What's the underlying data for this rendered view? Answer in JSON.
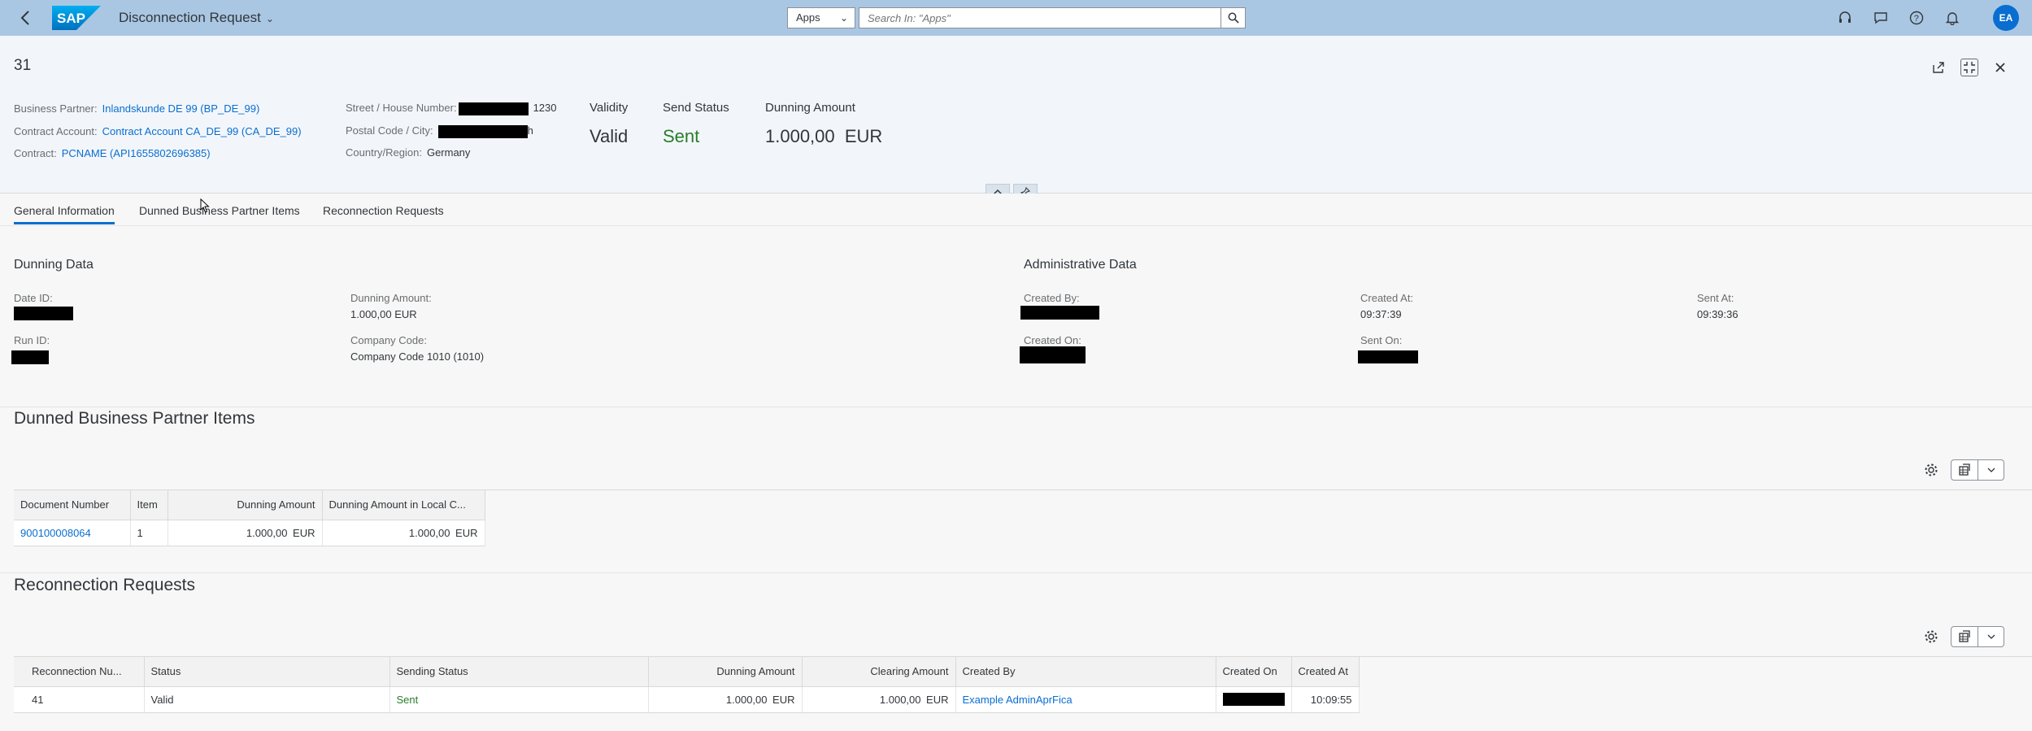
{
  "shell": {
    "title": "Disconnection Request",
    "search_scope": "Apps",
    "search_placeholder": "Search In: \"Apps\"",
    "avatar_initials": "EA",
    "colors": {
      "bar": "#a9c7e3",
      "avatar": "#0a6ed1"
    }
  },
  "header": {
    "object_id": "31",
    "business_partner_label": "Business Partner:",
    "business_partner_value": "Inlandskunde DE 99 (BP_DE_99)",
    "contract_account_label": "Contract Account:",
    "contract_account_value": "Contract Account CA_DE_99 (CA_DE_99)",
    "contract_label": "Contract:",
    "contract_value": "PCNAME (API1655802696385)",
    "street_label": "Street / House Number:",
    "street_suffix": "1230",
    "postal_label": "Postal Code / City:",
    "postal_suffix": "h",
    "country_label": "Country/Region:",
    "country_value": "Germany",
    "validity_label": "Validity",
    "validity_value": "Valid",
    "send_status_label": "Send Status",
    "send_status_value": "Sent",
    "dunning_amount_label": "Dunning Amount",
    "dunning_amount_value": "1.000,00",
    "dunning_amount_currency": "EUR"
  },
  "tabs": [
    {
      "label": "General Information"
    },
    {
      "label": "Dunned Business Partner Items"
    },
    {
      "label": "Reconnection Requests"
    }
  ],
  "general": {
    "dunning_data_title": "Dunning Data",
    "date_id_label": "Date ID:",
    "run_id_label": "Run ID:",
    "dunning_amount_label": "Dunning Amount:",
    "dunning_amount_value": "1.000,00  EUR",
    "company_code_label": "Company Code:",
    "company_code_value": "Company Code 1010 (1010)",
    "admin_title": "Administrative Data",
    "created_by_label": "Created By:",
    "created_on_label": "Created On:",
    "created_at_label": "Created At:",
    "created_at_value": "09:37:39",
    "sent_on_label": "Sent On:",
    "sent_at_label": "Sent At:",
    "sent_at_value": "09:39:36"
  },
  "dunned_items": {
    "title": "Dunned Business Partner Items",
    "columns": [
      "Document Number",
      "Item",
      "Dunning Amount",
      "Dunning Amount in Local C..."
    ],
    "rows": [
      {
        "document_number": "900100008064",
        "item": "1",
        "dunning_amount": "1.000,00",
        "dunning_currency": "EUR",
        "local_amount": "1.000,00",
        "local_currency": "EUR"
      }
    ]
  },
  "reconnection": {
    "title": "Reconnection Requests",
    "columns": [
      "Reconnection Nu...",
      "Status",
      "Sending Status",
      "Dunning Amount",
      "Clearing Amount",
      "Created By",
      "Created On",
      "Created At"
    ],
    "rows": [
      {
        "number": "41",
        "status": "Valid",
        "sending_status": "Sent",
        "dunning_amount": "1.000,00",
        "dunning_currency": "EUR",
        "clearing_amount": "1.000,00",
        "clearing_currency": "EUR",
        "created_by": "Example AdminAprFica",
        "created_at": "10:09:55"
      }
    ],
    "status_color": "#2b7c2b"
  }
}
